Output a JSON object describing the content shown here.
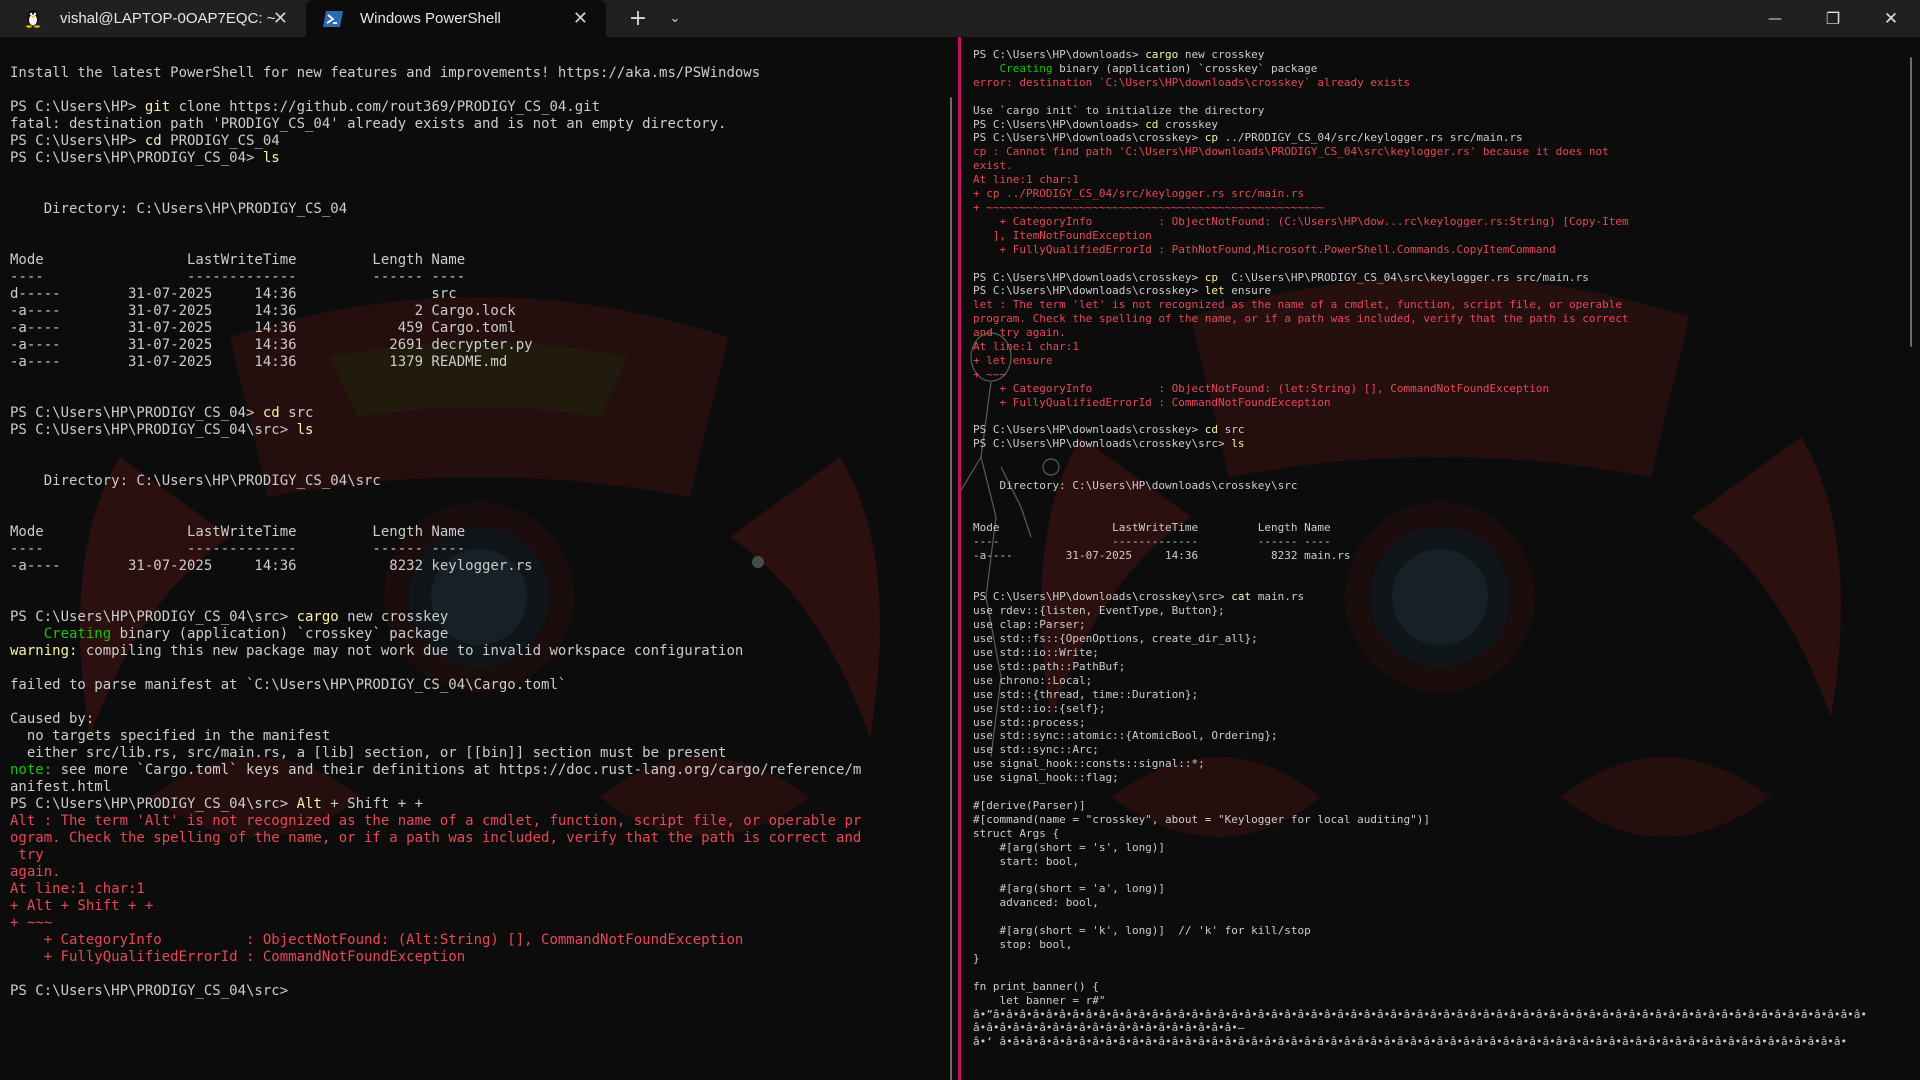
{
  "tabs": [
    {
      "title": "vishal@LAPTOP-0OAP7EQC: ~",
      "icon": "linux-penguin-icon",
      "active": false
    },
    {
      "title": "Windows PowerShell",
      "icon": "powershell-icon",
      "active": true
    }
  ],
  "titlebar": {
    "new_tab": "+",
    "dropdown": "⌄",
    "minimize": "—",
    "maximize": "❐",
    "close": "✕",
    "tab_close": "✕"
  },
  "colors": {
    "background": "#0c0c0c",
    "titlebar": "#202020",
    "divider": "#c50f63",
    "command": "#f9f1a5",
    "success": "#16c60c",
    "error": "#e74856",
    "text": "#cccccc"
  },
  "left_pane": {
    "lines": [
      "Install the latest PowerShell for new features and improvements! https://aka.ms/PSWindows",
      "",
      "PS C:\\Users\\HP> |git| clone https://github.com/rout369/PRODIGY_CS_04.git",
      "fatal: destination path 'PRODIGY_CS_04' already exists and is not an empty directory.",
      "PS C:\\Users\\HP> |cd| PRODIGY_CS_04",
      "PS C:\\Users\\HP\\PRODIGY_CS_04> |ls|",
      "",
      "",
      "    Directory: C:\\Users\\HP\\PRODIGY_CS_04",
      "",
      "",
      "Mode                 LastWriteTime         Length Name",
      "----                 -------------         ------ ----",
      "d-----        31-07-2025     14:36                src",
      "-a----        31-07-2025     14:36              2 Cargo.lock",
      "-a----        31-07-2025     14:36            459 Cargo.toml",
      "-a----        31-07-2025     14:36           2691 decrypter.py",
      "-a----        31-07-2025     14:36           1379 README.md",
      "",
      "",
      "PS C:\\Users\\HP\\PRODIGY_CS_04> |cd| src",
      "PS C:\\Users\\HP\\PRODIGY_CS_04\\src> |ls|",
      "",
      "",
      "    Directory: C:\\Users\\HP\\PRODIGY_CS_04\\src",
      "",
      "",
      "Mode                 LastWriteTime         Length Name",
      "----                 -------------         ------ ----",
      "-a----        31-07-2025     14:36           8232 keylogger.rs",
      "",
      "",
      "PS C:\\Users\\HP\\PRODIGY_CS_04\\src> |cargo| new crosskey",
      "    Creating binary (application) `crosskey` package",
      "warning: compiling this new package may not work due to invalid workspace configuration",
      "",
      "failed to parse manifest at `C:\\Users\\HP\\PRODIGY_CS_04\\Cargo.toml`",
      "",
      "Caused by:",
      "  no targets specified in the manifest",
      "  either src/lib.rs, src/main.rs, a [lib] section, or [[bin]] section must be present",
      "note: see more `Cargo.toml` keys and their definitions at https://doc.rust-lang.org/cargo/reference/m",
      "anifest.html",
      "PS C:\\Users\\HP\\PRODIGY_CS_04\\src> |Alt| + Shift + +",
      "Alt : The term 'Alt' is not recognized as the name of a cmdlet, function, script file, or operable pr",
      "ogram. Check the spelling of the name, or if a path was included, verify that the path is correct and",
      " try",
      "again.",
      "At line:1 char:1",
      "+ Alt + Shift + +",
      "+ ~~~",
      "    + CategoryInfo          : ObjectNotFound: (Alt:String) [], CommandNotFoundException",
      "    + FullyQualifiedErrorId : CommandNotFoundException",
      "",
      "PS C:\\Users\\HP\\PRODIGY_CS_04\\src> "
    ],
    "styles": [
      "n",
      "n",
      "c",
      "n",
      "c",
      "c",
      "n",
      "n",
      "n",
      "n",
      "n",
      "n",
      "n",
      "n",
      "n",
      "n",
      "n",
      "n",
      "n",
      "n",
      "c",
      "c",
      "n",
      "n",
      "n",
      "n",
      "n",
      "n",
      "n",
      "n",
      "n",
      "n",
      "c",
      "ok",
      "warn",
      "n",
      "n",
      "n",
      "n",
      "n",
      "n",
      "note",
      "n",
      "c",
      "e",
      "e",
      "e",
      "e",
      "e",
      "e",
      "e",
      "e",
      "e",
      "n",
      "n"
    ]
  },
  "right_pane": {
    "lines": [
      "PS C:\\Users\\HP\\downloads> |cargo| new crosskey",
      "    Creating binary (application) `crosskey` package",
      "error: destination `C:\\Users\\HP\\downloads\\crosskey` already exists",
      "",
      "Use `cargo init` to initialize the directory",
      "PS C:\\Users\\HP\\downloads> |cd| crosskey",
      "PS C:\\Users\\HP\\downloads\\crosskey> |cp| ../PRODIGY_CS_04/src/keylogger.rs src/main.rs",
      "cp : Cannot find path 'C:\\Users\\HP\\downloads\\PRODIGY_CS_04\\src\\keylogger.rs' because it does not",
      "exist.",
      "At line:1 char:1",
      "+ cp ../PRODIGY_CS_04/src/keylogger.rs src/main.rs",
      "+ ~~~~~~~~~~~~~~~~~~~~~~~~~~~~~~~~~~~~~~~~~~~~~~~~~~~",
      "    + CategoryInfo          : ObjectNotFound: (C:\\Users\\HP\\dow...rc\\keylogger.rs:String) [Copy-Item",
      "   ], ItemNotFoundException",
      "    + FullyQualifiedErrorId : PathNotFound,Microsoft.PowerShell.Commands.CopyItemCommand",
      "",
      "PS C:\\Users\\HP\\downloads\\crosskey> |cp|  C:\\Users\\HP\\PRODIGY_CS_04\\src\\keylogger.rs src/main.rs",
      "PS C:\\Users\\HP\\downloads\\crosskey> |let| ensure",
      "let : The term 'let' is not recognized as the name of a cmdlet, function, script file, or operable",
      "program. Check the spelling of the name, or if a path was included, verify that the path is correct",
      "and try again.",
      "At line:1 char:1",
      "+ let ensure",
      "+ ~~~",
      "    + CategoryInfo          : ObjectNotFound: (let:String) [], CommandNotFoundException",
      "    + FullyQualifiedErrorId : CommandNotFoundException",
      "",
      "PS C:\\Users\\HP\\downloads\\crosskey> |cd| src",
      "PS C:\\Users\\HP\\downloads\\crosskey\\src> |ls|",
      "",
      "",
      "    Directory: C:\\Users\\HP\\downloads\\crosskey\\src",
      "",
      "",
      "Mode                 LastWriteTime         Length Name",
      "----                 -------------         ------ ----",
      "-a----        31-07-2025     14:36           8232 main.rs",
      "",
      "",
      "PS C:\\Users\\HP\\downloads\\crosskey\\src> |cat| main.rs",
      "use rdev::{listen, EventType, Button};",
      "use clap::Parser;",
      "use std::fs::{OpenOptions, create_dir_all};",
      "use std::io::Write;",
      "use std::path::PathBuf;",
      "use chrono::Local;",
      "use std::{thread, time::Duration};",
      "use std::io::{self};",
      "use std::process;",
      "use std::sync::atomic::{AtomicBool, Ordering};",
      "use std::sync::Arc;",
      "use signal_hook::consts::signal::*;",
      "use signal_hook::flag;",
      "",
      "#[derive(Parser)]",
      "#[command(name = \"crosskey\", about = \"Keylogger for local auditing\")]",
      "struct Args {",
      "    #[arg(short = 's', long)]",
      "    start: bool,",
      "",
      "    #[arg(short = 'a', long)]",
      "    advanced: bool,",
      "",
      "    #[arg(short = 'k', long)]  // 'k' for kill/stop",
      "    stop: bool,",
      "}",
      "",
      "fn print_banner() {",
      "    let banner = r#\"",
      "â•”â•â•â•â•â•â•â•â•â•â•â•â•â•â•â•â•â•â•â•â•â•â•â•â•â•â•â•â•â•â•â•â•â•â•â•â•â•â•â•â•â•â•â•â•â•â•â•â•â•â•â•â•â•â•â•â•â•â•â•â•â•â•â•â•â•â•",
      "â•â•â•â•â•â•â•â•â•â•â•â•â•â•â•â•â•â•â•â•—",
      "â•‘ â•â•â•â•â•â•â•â•â•â•â•â•â•â•â•â•â•â•â•â•â•â•â•â•â•â•â•â•â•â•â•â•â•â•â•â•â•â•â•â•â•â•â•â•â•â•â•â•â•â•â•â•â•â•â•â•â•â•â•â•â•â•â•â•"
    ],
    "styles": [
      "c",
      "ok",
      "e",
      "n",
      "n",
      "c",
      "c",
      "e",
      "e",
      "e",
      "e",
      "e",
      "e",
      "e",
      "e",
      "n",
      "c",
      "c",
      "e",
      "e",
      "e",
      "e",
      "e",
      "e",
      "e",
      "e",
      "n",
      "c",
      "c",
      "n",
      "n",
      "n",
      "n",
      "n",
      "n",
      "n",
      "n",
      "n",
      "n",
      "c",
      "n",
      "n",
      "n",
      "n",
      "n",
      "n",
      "n",
      "n",
      "n",
      "n",
      "n",
      "n",
      "n",
      "n",
      "n",
      "n",
      "n",
      "n",
      "n",
      "n",
      "n",
      "n",
      "n",
      "n",
      "n",
      "n",
      "n",
      "n",
      "n",
      "n",
      "n",
      "n",
      "n"
    ]
  }
}
